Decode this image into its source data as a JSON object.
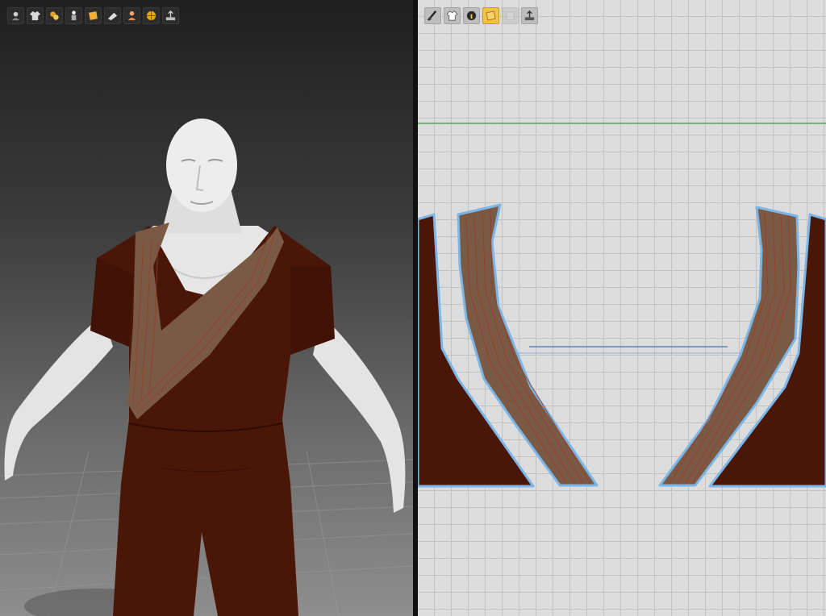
{
  "app": {
    "title": ""
  },
  "viewport3d": {
    "toolbar": [
      {
        "name": "avatar-display-icon",
        "state": "normal"
      },
      {
        "name": "garment-display-icon",
        "state": "normal"
      },
      {
        "name": "fabric-render-icon",
        "state": "normal"
      },
      {
        "name": "avatar-pose-icon",
        "state": "normal"
      },
      {
        "name": "texture-display-icon",
        "state": "normal"
      },
      {
        "name": "pin-icon",
        "state": "normal"
      },
      {
        "name": "skin-display-icon",
        "state": "normal"
      },
      {
        "name": "grid-sphere-icon",
        "state": "normal"
      },
      {
        "name": "export-icon",
        "state": "normal"
      }
    ]
  },
  "viewport2d": {
    "toolbar": [
      {
        "name": "show-pattern-icon",
        "state": "normal"
      },
      {
        "name": "show-grain-icon",
        "state": "normal"
      },
      {
        "name": "info-icon",
        "state": "normal"
      },
      {
        "name": "texture-view-icon",
        "state": "active"
      },
      {
        "name": "layer-icon",
        "state": "disabled"
      },
      {
        "name": "export-icon",
        "state": "normal"
      }
    ]
  },
  "colors": {
    "fabric_body": "#4a1608",
    "fabric_collar": "#7a5a44",
    "pattern_outline": "#7ab6e8",
    "baseline": "#5e9a62",
    "active_tool": "#f0c24a"
  }
}
